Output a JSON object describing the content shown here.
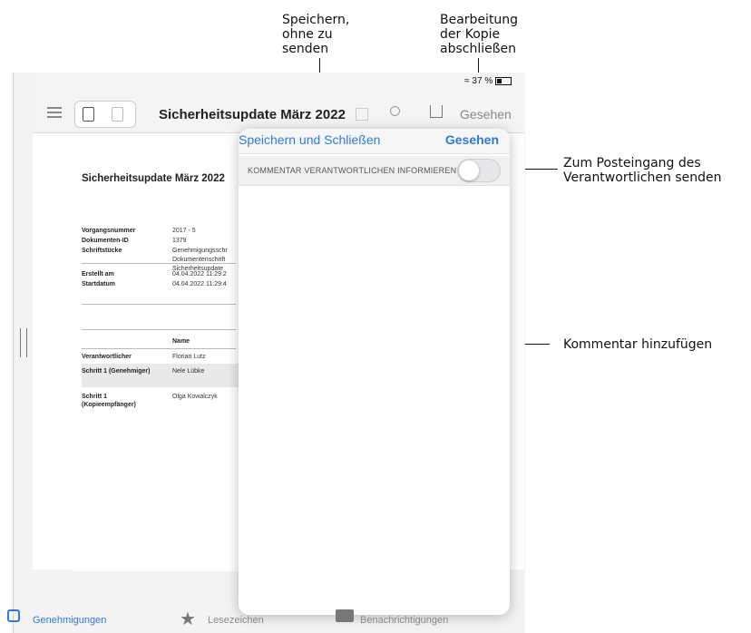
{
  "annotations": {
    "save_without_send": "Speichern,\nohne zu\nsenden",
    "finish_copy": "Bearbeitung\nder Kopie\nabschließen",
    "to_inbox": "Zum Posteingang des\nVerantwortlichen senden",
    "add_comment": "Kommentar hinzufügen"
  },
  "status_bar": {
    "battery": "37 %"
  },
  "toolbar": {
    "title": "Sicherheitsupdate März 2022",
    "seen_button": "Gesehen"
  },
  "document": {
    "title": "Sicherheitsupdate März 2022",
    "fields": [
      {
        "key": "Vorgangsnummer",
        "value": "2017 - 5"
      },
      {
        "key": "Dokumenten-ID",
        "value": "1379"
      },
      {
        "key": "Schriftstücke",
        "value": "Genehmigungsschr"
      },
      {
        "key": "",
        "value": "Dokumentenschrift"
      },
      {
        "key": "",
        "value": "Sicherheitsupdate"
      }
    ],
    "dates": [
      {
        "key": "Erstellt am",
        "value": "04.04.2022 11:29:2"
      },
      {
        "key": "Startdatum",
        "value": "04.04.2022 11:29:4"
      }
    ],
    "name_header": "Name",
    "people": [
      {
        "role": "Verantwortlicher",
        "name": "Florian Lutz"
      },
      {
        "role": "Schritt 1 (Genehmiger)",
        "name": "Nele Lübke"
      },
      {
        "role": "Schritt 1 (Kopieempfänger)",
        "name": "Olga Kowalczyk"
      }
    ]
  },
  "popover": {
    "save_close": "Speichern und Schließen",
    "seen": "Gesehen",
    "toggle_label": "KOMMENTAR VERANTWORTLICHEN INFORMIEREN",
    "toggle_on": false
  },
  "tabbar": {
    "items": [
      {
        "label": "Genehmigungen",
        "active": true
      },
      {
        "label": "Lesezeichen",
        "active": false
      },
      {
        "label": "Benachrichtigungen",
        "active": false
      }
    ]
  },
  "colors": {
    "accent": "#2a7bdc"
  }
}
